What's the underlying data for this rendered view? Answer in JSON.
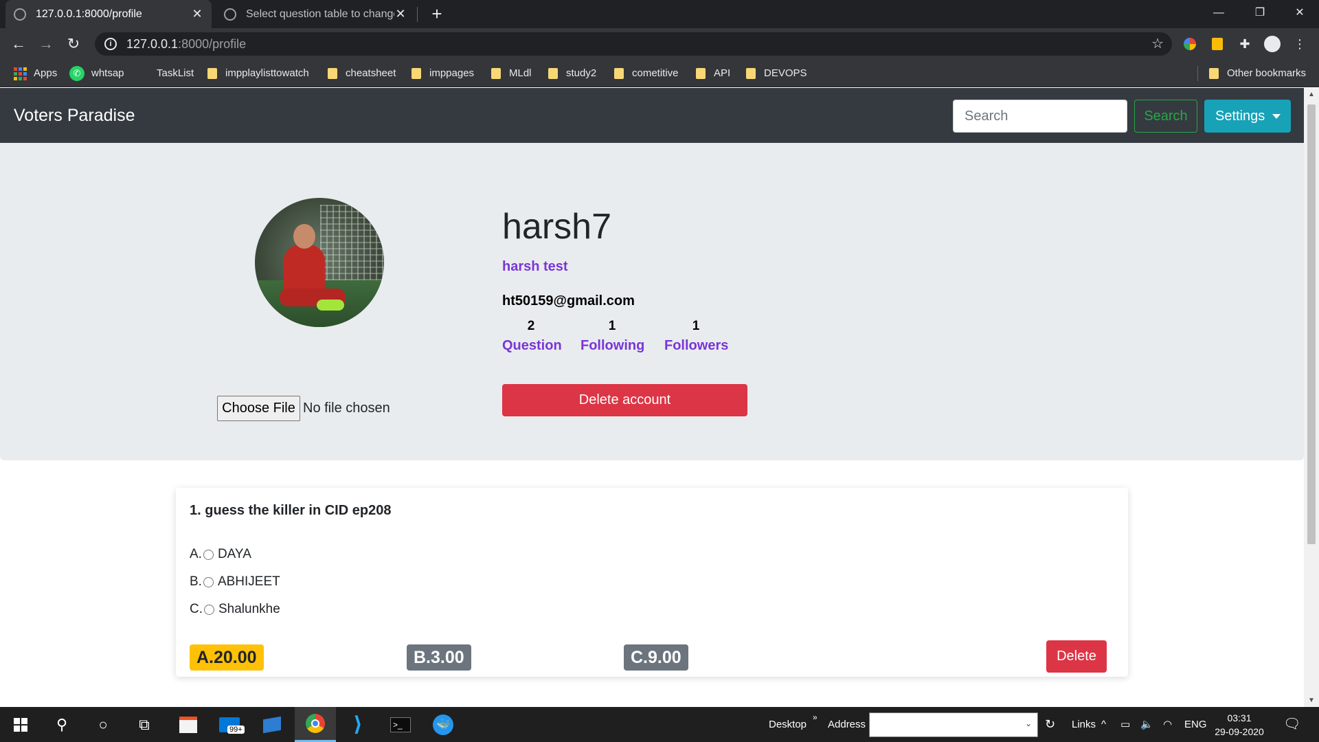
{
  "browser": {
    "tabs": [
      {
        "title": "127.0.0.1:8000/profile",
        "active": true
      },
      {
        "title": "Select question table to change |",
        "active": false
      }
    ],
    "new_tab_label": "+",
    "url_host": "127.0.0.1",
    "url_path": ":8000/profile",
    "bookmarks": [
      {
        "label": "Apps",
        "kind": "apps"
      },
      {
        "label": "whtsap",
        "kind": "whatsapp"
      },
      {
        "label": "TaskList",
        "kind": "plain"
      },
      {
        "label": "impplaylisttowatch",
        "kind": "folder"
      },
      {
        "label": "cheatsheet",
        "kind": "folder"
      },
      {
        "label": "imppages",
        "kind": "folder"
      },
      {
        "label": "MLdl",
        "kind": "folder"
      },
      {
        "label": "study2",
        "kind": "folder"
      },
      {
        "label": "cometitive",
        "kind": "folder"
      },
      {
        "label": "API",
        "kind": "folder"
      },
      {
        "label": "DEVOPS",
        "kind": "folder"
      }
    ],
    "other_bookmarks": "Other bookmarks"
  },
  "navbar": {
    "brand": "Voters Paradise",
    "search_placeholder": "Search",
    "search_button": "Search",
    "settings_button": "Settings"
  },
  "profile": {
    "username": "harsh7",
    "full_name": "harsh test",
    "email": "ht50159@gmail.com",
    "stats": [
      {
        "count": "2",
        "label": "Question"
      },
      {
        "count": "1",
        "label": "Following"
      },
      {
        "count": "1",
        "label": "Followers"
      }
    ],
    "choose_file_label": "Choose File",
    "file_status": "No file chosen",
    "delete_account_label": "Delete account"
  },
  "question": {
    "title": "1. guess the killer in CID ep208",
    "options": [
      {
        "prefix": "A.",
        "text": "DAYA"
      },
      {
        "prefix": "B.",
        "text": "ABHIJEET"
      },
      {
        "prefix": "C.",
        "text": "Shalunkhe"
      }
    ],
    "results": [
      {
        "label": "A.20.00",
        "style": "warning"
      },
      {
        "label": "B.3.00",
        "style": "secondary"
      },
      {
        "label": "C.9.00",
        "style": "secondary"
      }
    ],
    "delete_label": "Delete"
  },
  "taskbar": {
    "desktop_label": "Desktop",
    "address_label": "Address",
    "links_label": "Links",
    "language": "ENG",
    "time": "03:31",
    "date": "29-09-2020",
    "mail_badge": "99+"
  },
  "colors": {
    "navbar_bg": "#343a40",
    "jumbotron_bg": "#e9ecef",
    "danger": "#dc3545",
    "info": "#17a2b8",
    "success": "#28a745",
    "warning": "#ffc107",
    "secondary": "#6c757d",
    "accent_purple": "#7a35d6"
  }
}
